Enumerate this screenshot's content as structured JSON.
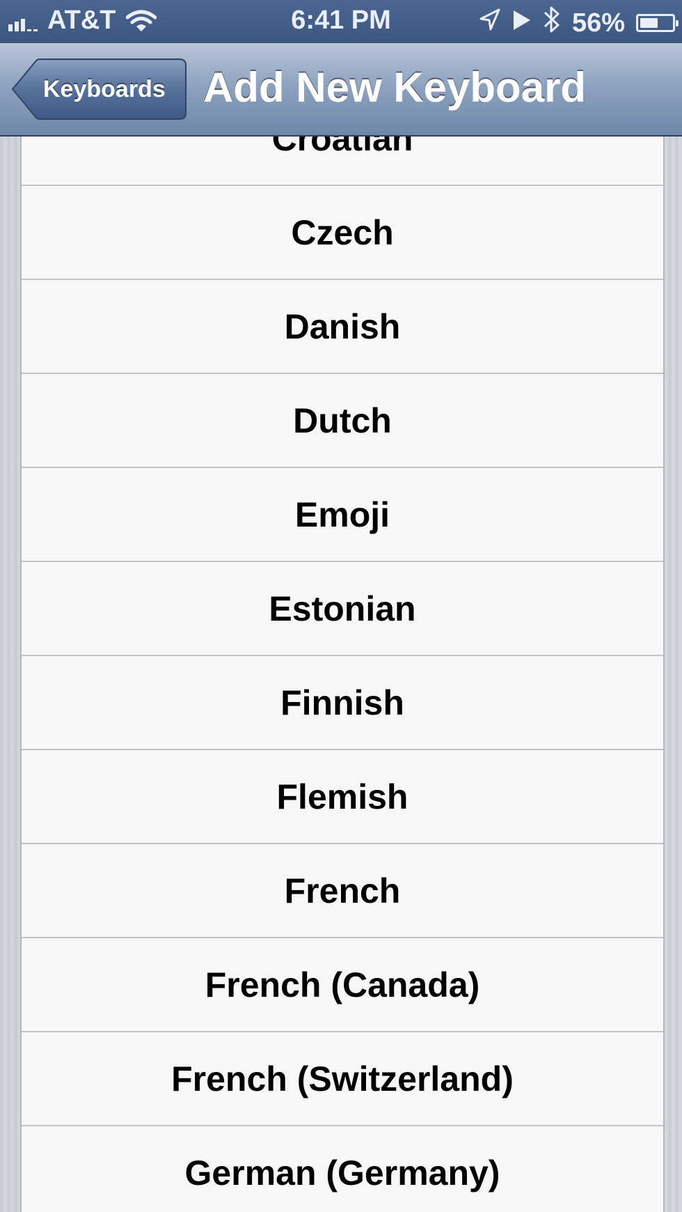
{
  "status_bar": {
    "carrier": "AT&T",
    "time": "6:41 PM",
    "battery_percent": "56%",
    "battery_level": 0.56,
    "icons": [
      "signal-icon",
      "wifi-icon",
      "location-icon",
      "play-icon",
      "bluetooth-icon",
      "battery-icon"
    ]
  },
  "nav_bar": {
    "back_label": "Keyboards",
    "title": "Add New Keyboard"
  },
  "keyboards": [
    "Croatian",
    "Czech",
    "Danish",
    "Dutch",
    "Emoji",
    "Estonian",
    "Finnish",
    "Flemish",
    "French",
    "French (Canada)",
    "French (Switzerland)",
    "German (Germany)"
  ],
  "colors": {
    "status_bar": "#3c5680",
    "nav_bar_top": "#b9c6d8",
    "nav_bar_bottom": "#6e86a9",
    "row_background": "#f7f7f7",
    "row_separator": "#c0c3c8"
  }
}
